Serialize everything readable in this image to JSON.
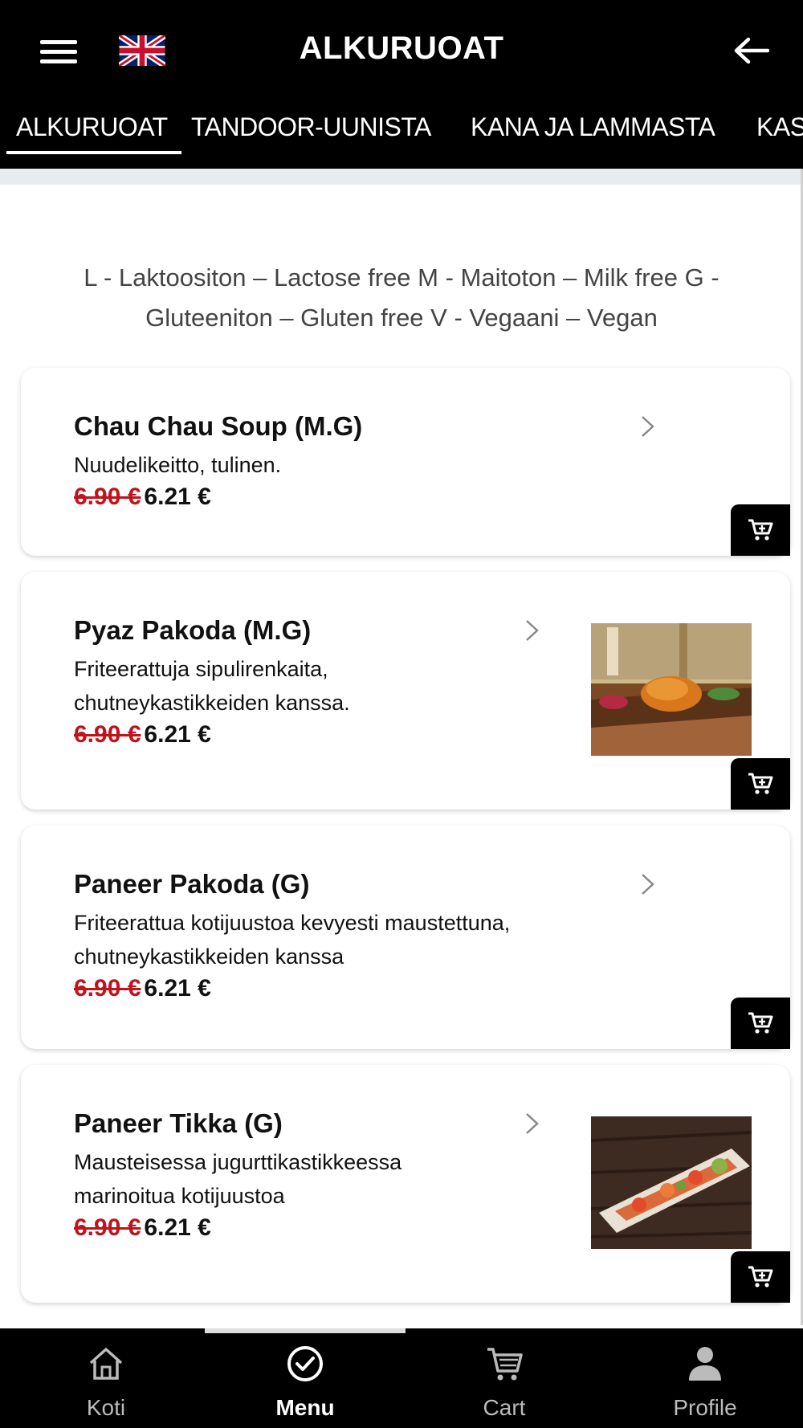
{
  "header": {
    "title": "ALKURUOAT",
    "menu_icon": "hamburger-menu-icon",
    "language_icon": "uk-flag-icon",
    "back_icon": "arrow-left-icon"
  },
  "tabs": [
    {
      "label": "ALKURUOAT",
      "active": true
    },
    {
      "label": "TANDOOR-UUNISTA",
      "active": false
    },
    {
      "label": "KANA JA LAMMASTA",
      "active": false
    },
    {
      "label": "KAS",
      "active": false
    }
  ],
  "legend": {
    "line1": "L - Laktoositon – Lactose free M - Maitoton – Milk free G -",
    "line2": "Gluteeniton – Gluten free V - Vegaani – Vegan"
  },
  "items": [
    {
      "name": "Chau Chau Soup (M.G)",
      "desc": [
        "Nuudelikeitto, tulinen."
      ],
      "old_price": "6.90 €",
      "new_price": "6.21 €",
      "has_image": false
    },
    {
      "name": "Pyaz Pakoda (M.G)",
      "desc": [
        "Friteerattuja sipulirenkaita,",
        "chutneykastikkeiden kanssa."
      ],
      "old_price": "6.90 €",
      "new_price": "6.21 €",
      "has_image": true
    },
    {
      "name": "Paneer Pakoda (G)",
      "desc": [
        "Friteerattua kotijuustoa kevyesti maustettuna,",
        "chutneykastikkeiden kanssa"
      ],
      "old_price": "6.90 €",
      "new_price": "6.21 €",
      "has_image": false
    },
    {
      "name": "Paneer Tikka (G)",
      "desc": [
        "Mausteisessa jugurttikastikkeessa",
        "marinoitua kotijuustoa"
      ],
      "old_price": "6.90 €",
      "new_price": "6.21 €",
      "has_image": true
    }
  ],
  "bottom_nav": [
    {
      "label": "Koti",
      "icon": "home-icon",
      "active": false
    },
    {
      "label": "Menu",
      "icon": "check-circle-icon",
      "active": true
    },
    {
      "label": "Cart",
      "icon": "cart-icon",
      "active": false
    },
    {
      "label": "Profile",
      "icon": "person-icon",
      "active": false
    }
  ],
  "colors": {
    "header_bg": "#000000",
    "old_price": "#c0141c",
    "nav_inactive": "#bbbbbb"
  }
}
